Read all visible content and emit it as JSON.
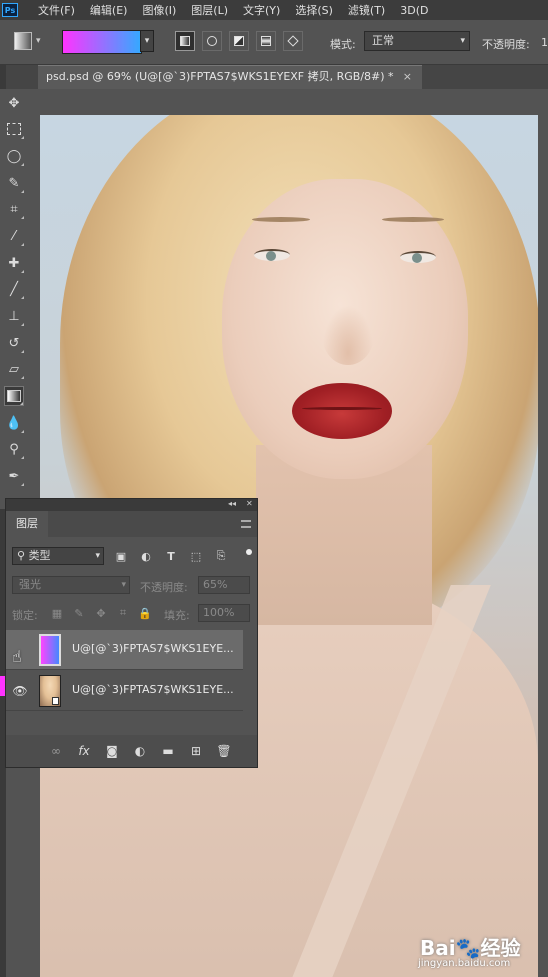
{
  "app": {
    "logo": "Ps"
  },
  "menu": [
    "文件(F)",
    "编辑(E)",
    "图像(I)",
    "图层(L)",
    "文字(Y)",
    "选择(S)",
    "滤镜(T)",
    "3D(D"
  ],
  "options": {
    "gradient_colors": [
      "#ff33ff",
      "#33aaff"
    ],
    "mode_label": "模式:",
    "mode_value": "正常",
    "opacity_label": "不透明度:",
    "opacity_value": "1"
  },
  "document": {
    "tab_title": "psd.psd @ 69% (U@[@`3)FPTAS7$WKS1EYEXF 拷贝, RGB/8#) *",
    "close_glyph": "×"
  },
  "tools": [
    "move-icon",
    "marquee-icon",
    "lasso-icon",
    "quick-select-icon",
    "crop-icon",
    "eyedropper-icon",
    "healing-icon",
    "brush-icon",
    "stamp-icon",
    "history-brush-icon",
    "eraser-icon",
    "gradient-icon",
    "blur-icon",
    "dodge-icon",
    "pen-icon"
  ],
  "layers_panel": {
    "tab": "图层",
    "filter_label": "类型",
    "blend_mode": "强光",
    "opacity_label": "不透明度:",
    "opacity_value": "65%",
    "lock_label": "锁定:",
    "fill_label": "填充:",
    "fill_value": "100%",
    "layers": [
      {
        "name": "U@[@`3)FPTAS7$WKS1EYE...",
        "type": "gradient",
        "visible": false,
        "selected": true
      },
      {
        "name": "U@[@`3)FPTAS7$WKS1EYE...",
        "type": "photo",
        "visible": true,
        "selected": false
      }
    ]
  },
  "watermark": {
    "text": "Bai🐾经验",
    "sub": "jingyan.baidu.com"
  }
}
